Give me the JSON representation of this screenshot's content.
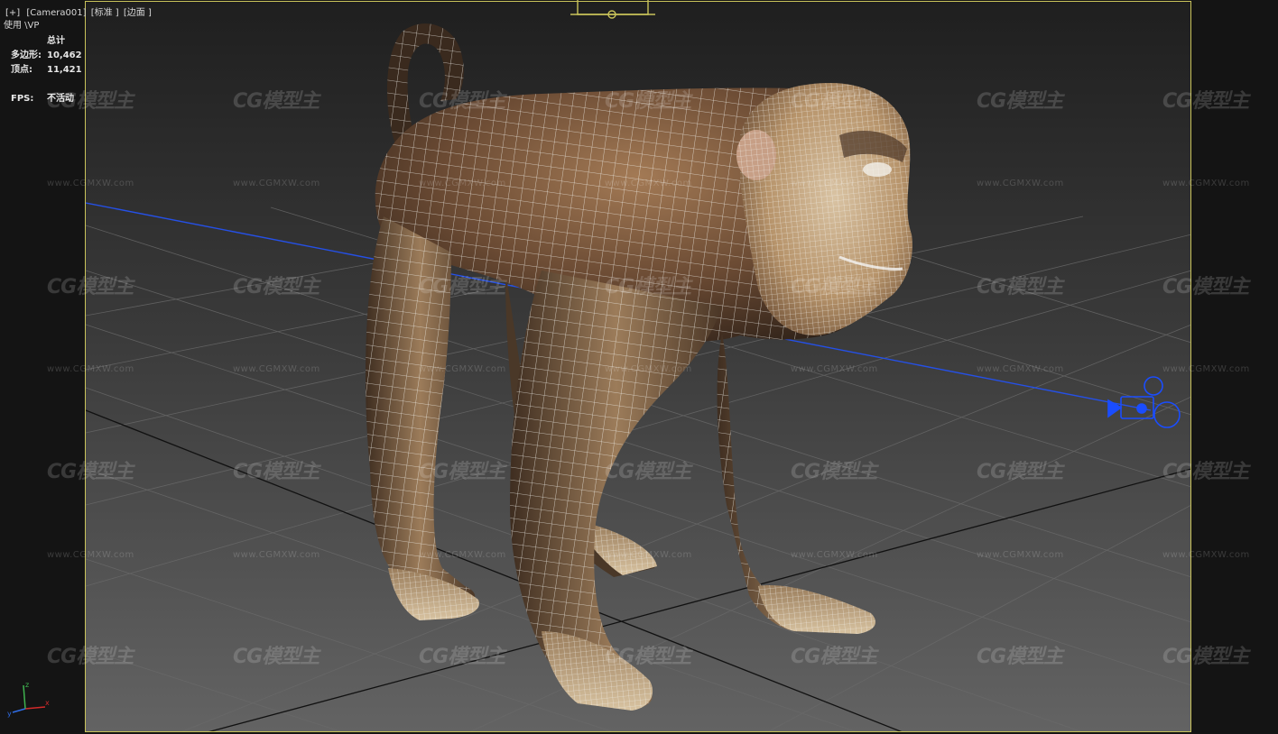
{
  "viewport": {
    "menu_plus": "[+]",
    "menu_camera": "[Camera001]",
    "menu_shading": "[标准 ]",
    "menu_edges": "[边面 ]",
    "sub_label": "使用 \\VP"
  },
  "stats": {
    "header": "总计",
    "polygons_label": "多边形:",
    "polygons_value": "10,462",
    "vertices_label": "顶点:",
    "vertices_value": "11,421",
    "fps_label": "FPS:",
    "fps_value": "不活动"
  },
  "watermark": {
    "logo": "CG模型主",
    "url": "www.CGMXW.com"
  },
  "colors": {
    "safe_frame": "#c9c35a",
    "grid_line": "#5a5a5a",
    "background_light": "#5d5d5d",
    "background_dark": "#1e1e1e",
    "fur_dark": "#3c2a1c",
    "fur_light": "#c9ad86",
    "wireframe": "#f2f2ee",
    "camera_gizmo": "#1a4dff"
  },
  "icons": {
    "camera": "camera-target-icon",
    "axis": "axis-tripod-icon"
  }
}
